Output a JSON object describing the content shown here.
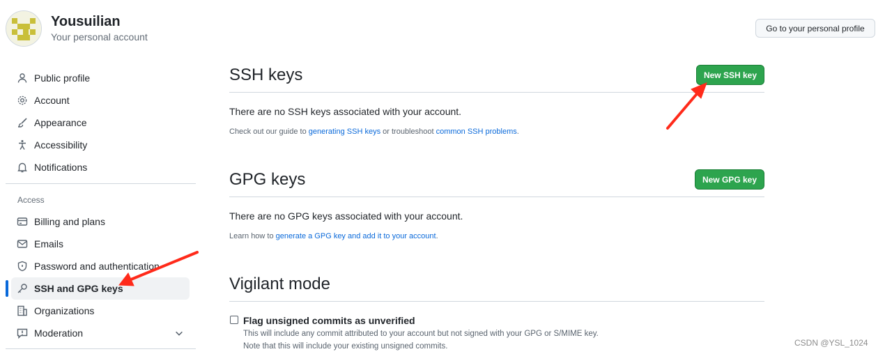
{
  "header": {
    "username": "Yousuilian",
    "subtitle": "Your personal account",
    "profile_button": "Go to your personal profile"
  },
  "sidebar": {
    "items_top": [
      {
        "label": "Public profile",
        "icon": "person-icon"
      },
      {
        "label": "Account",
        "icon": "gear-icon"
      },
      {
        "label": "Appearance",
        "icon": "paintbrush-icon"
      },
      {
        "label": "Accessibility",
        "icon": "accessibility-icon"
      },
      {
        "label": "Notifications",
        "icon": "bell-icon"
      }
    ],
    "access_label": "Access",
    "items_access": [
      {
        "label": "Billing and plans",
        "icon": "credit-card-icon"
      },
      {
        "label": "Emails",
        "icon": "mail-icon"
      },
      {
        "label": "Password and authentication",
        "icon": "shield-icon"
      },
      {
        "label": "SSH and GPG keys",
        "icon": "key-icon",
        "active": true
      },
      {
        "label": "Organizations",
        "icon": "organization-icon"
      },
      {
        "label": "Moderation",
        "icon": "report-icon"
      }
    ]
  },
  "ssh": {
    "title": "SSH keys",
    "button": "New SSH key",
    "empty_text": "There are no SSH keys associated with your account.",
    "note_prefix": "Check out our guide to ",
    "note_link1": "generating SSH keys",
    "note_mid": " or troubleshoot ",
    "note_link2": "common SSH problems",
    "note_suffix": "."
  },
  "gpg": {
    "title": "GPG keys",
    "button": "New GPG key",
    "empty_text": "There are no GPG keys associated with your account.",
    "note_prefix": "Learn how to ",
    "note_link": "generate a GPG key and add it to your account",
    "note_suffix": "."
  },
  "vigilant": {
    "title": "Vigilant mode",
    "checkbox_label": "Flag unsigned commits as unverified",
    "checked": false,
    "help_line1": "This will include any commit attributed to your account but not signed with your GPG or S/MIME key.",
    "help_line2": "Note that this will include your existing unsigned commits."
  },
  "watermark": "CSDN @YSL_1024",
  "colors": {
    "primary_button": "#2da44e",
    "link": "#0969da",
    "active_indicator": "#0969da",
    "annotation_arrow": "#ff2a1a"
  }
}
